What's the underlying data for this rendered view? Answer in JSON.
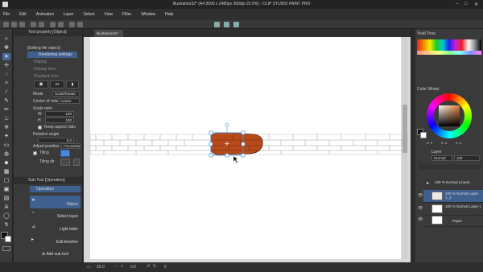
{
  "window": {
    "title": "Illustration32* (A4 3500 x 2480px 300dpi 25.0%) - CLIP STUDIO PAINT PRO",
    "minimize": "–",
    "maximize": "□",
    "close": "✕"
  },
  "menu": [
    "File",
    "Edit",
    "Animation",
    "Layer",
    "Select",
    "View",
    "Filter",
    "Window",
    "Help"
  ],
  "document_tab": {
    "label": "Illustration32*",
    "close": "×"
  },
  "tool_property": {
    "header": "Tool property [Object]",
    "editing_label": "[Editing file object]",
    "rendering_settings": "Rendering settings",
    "display": "Display",
    "display_item": "Display item",
    "playback_time": "Playback time",
    "mode_label": "Mode",
    "mode_value": "Scale/Rotate",
    "center_label": "Center of rotation",
    "center_value": "Center",
    "scale_ratio": "Scale ratio",
    "w_label": "W",
    "w_value": "100",
    "h_label": "H",
    "h_value": "100",
    "keep_aspect": "Keep aspect ratio",
    "rotation_angle": "Rotation angle",
    "rotation_value": "0.0",
    "adjust_position": "Adjust position",
    "adjust_position_value": "Fit position",
    "tiling": "Tiling",
    "tiling_dir": "Tiling dir"
  },
  "sub_tool": {
    "header": "Sub Tool [Operation]",
    "group": "Operation",
    "items": [
      "Object",
      "Select layer",
      "Light table",
      "Edit timeline"
    ],
    "add": "Add sub tool"
  },
  "color_set": {
    "header": "Vivid Tone"
  },
  "color_wheel": {
    "header": "Color Wheel",
    "hue_label": "H",
    "s_label": "S",
    "v_label": "V",
    "h_value": "0",
    "s_value": "0",
    "v_value": "0"
  },
  "layer_panel": {
    "header": "Layer",
    "blend_mode": "Normal",
    "opacity": "100",
    "layers": [
      {
        "name": "100 % Normal Lineart",
        "selected": false
      },
      {
        "name": "100 % Normal Layer 1_2",
        "selected": true
      },
      {
        "name": "100 % Normal Layer 1",
        "selected": false
      },
      {
        "name": "Paper",
        "selected": false
      }
    ]
  },
  "status": {
    "zoom": "25.0",
    "angle": "0.0",
    "coords": "0"
  },
  "colors": {
    "accent": "#4a6a9a",
    "selection": "#3f5f8f",
    "brick_fill": "#b84a1a",
    "handle": "#4a8ad8"
  }
}
